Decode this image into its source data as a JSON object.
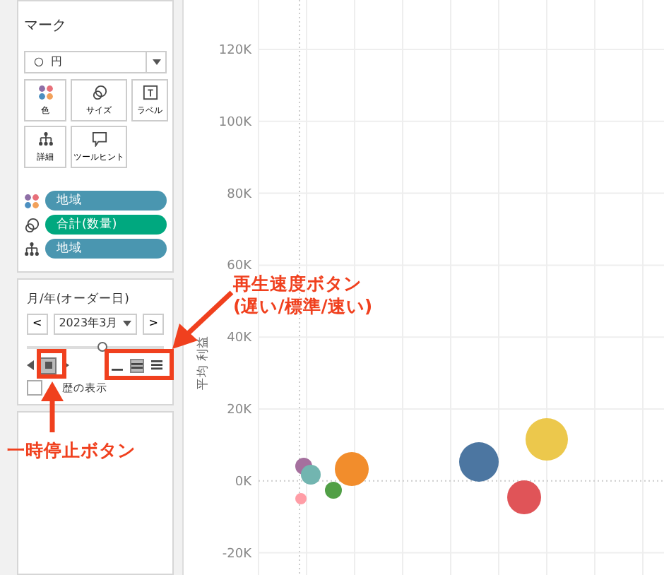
{
  "marks_card": {
    "title": "マーク",
    "mark_type": {
      "icon": "○",
      "label": "円"
    },
    "buttons": [
      {
        "kind": "color",
        "label": "色"
      },
      {
        "kind": "size",
        "label": "サイズ"
      },
      {
        "kind": "label",
        "label": "ラベル"
      },
      {
        "kind": "detail",
        "label": "詳細"
      },
      {
        "kind": "tooltip",
        "label": "ツールヒント"
      }
    ],
    "pills": [
      {
        "kind": "color",
        "label": "地域",
        "color": "#4a96b0"
      },
      {
        "kind": "size",
        "label": "合計(数量)",
        "color": "#00a87f"
      },
      {
        "kind": "detail",
        "label": "地域",
        "color": "#4a96b0"
      }
    ]
  },
  "pages_card": {
    "title": "月/年(オーダー日)",
    "prev": "<",
    "value": "2023年3月",
    "next": ">",
    "level": 0.55,
    "speeds": [
      {
        "selected": false
      },
      {
        "selected": true
      },
      {
        "selected": false
      }
    ],
    "show_history": {
      "checked": false,
      "label": "歴の表示"
    }
  },
  "chart": {
    "ylabel": "平均 利益",
    "yticks": [
      "120K",
      "100K",
      "80K",
      "60K",
      "40K",
      "20K",
      "0K",
      "-20K"
    ],
    "bubbles": [
      {
        "color": "#a5709e"
      },
      {
        "color": "#72b5b0"
      },
      {
        "color": "#f28d2c"
      },
      {
        "color": "#519f46"
      },
      {
        "color": "#ff9da6"
      },
      {
        "color": "#4c76a1"
      },
      {
        "color": "#ecc84c"
      },
      {
        "color": "#e05458"
      }
    ]
  },
  "annotations": [
    {
      "kind": "speed",
      "text": "再生速度ボタン\n(遅い/標準/速い)"
    },
    {
      "kind": "pause",
      "text": "一時停止ボタン"
    }
  ]
}
